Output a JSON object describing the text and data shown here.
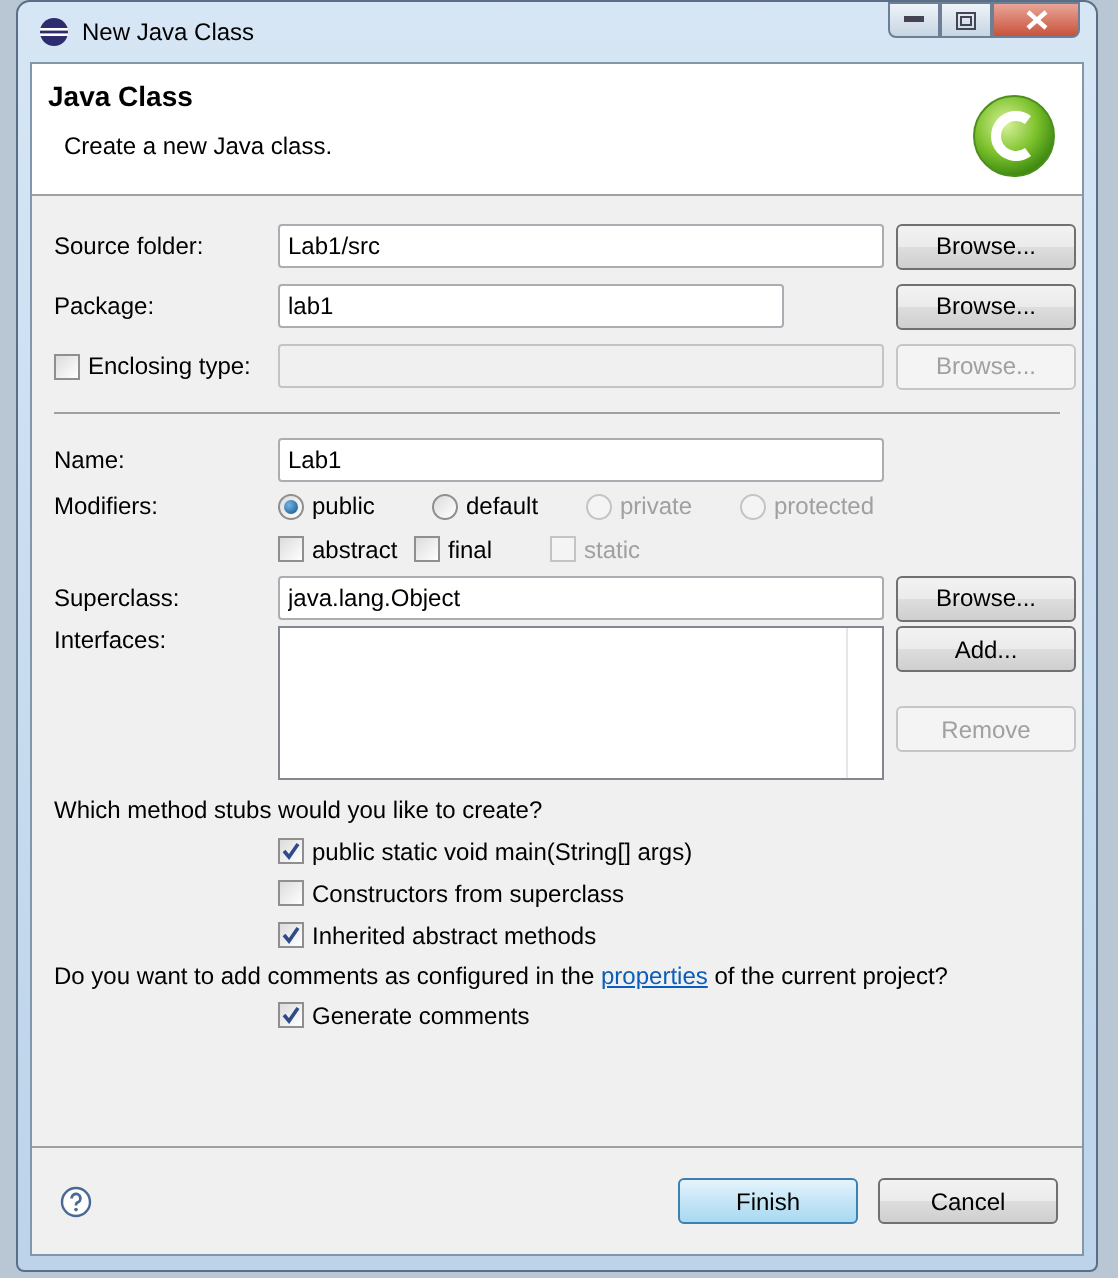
{
  "window": {
    "title": "New Java Class"
  },
  "header": {
    "title": "Java Class",
    "description": "Create a new Java class."
  },
  "location": [
    {
      "kind": "text",
      "label": "Source folder:",
      "value": "Lab1/src",
      "button": {
        "label": "Browse...",
        "disabled": false
      }
    },
    {
      "kind": "text",
      "label": "Package:",
      "value": "lab1",
      "button": {
        "label": "Browse...",
        "disabled": false
      }
    },
    {
      "kind": "checkbox",
      "label": "Enclosing type:",
      "checked": false,
      "disabled": true,
      "button": {
        "label": "Browse...",
        "disabled": true
      }
    }
  ],
  "name": {
    "label": "Name:",
    "value": "Lab1"
  },
  "modifiers": {
    "label": "Modifiers:",
    "access": [
      {
        "label": "public",
        "selected": true,
        "disabled": false
      },
      {
        "label": "default",
        "selected": false,
        "disabled": false
      },
      {
        "label": "private",
        "selected": false,
        "disabled": true
      },
      {
        "label": "protected",
        "selected": false,
        "disabled": true
      }
    ],
    "flags": [
      {
        "label": "abstract",
        "checked": false,
        "disabled": false
      },
      {
        "label": "final",
        "checked": false,
        "disabled": false
      },
      {
        "label": "static",
        "checked": false,
        "disabled": true
      }
    ]
  },
  "superclass": {
    "label": "Superclass:",
    "value": "java.lang.Object",
    "button": {
      "label": "Browse...",
      "disabled": false
    }
  },
  "interfaces": {
    "label": "Interfaces:",
    "buttons": [
      {
        "label": "Add...",
        "disabled": false
      },
      {
        "label": "Remove",
        "disabled": true
      }
    ]
  },
  "stubs": {
    "question": "Which method stubs would you like to create?",
    "options": [
      {
        "label": "public static void main(String[] args)",
        "checked": true
      },
      {
        "label": "Constructors from superclass",
        "checked": false
      },
      {
        "label": "Inherited abstract methods",
        "checked": true
      }
    ]
  },
  "comments": {
    "question_before": "Do you want to add comments as configured in the",
    "link": "properties",
    "question_after": "of the current project?",
    "options": [
      {
        "label": "Generate comments",
        "checked": true
      }
    ]
  },
  "footer": {
    "buttons": [
      {
        "label": "Finish",
        "default": true
      },
      {
        "label": "Cancel",
        "default": false
      }
    ]
  }
}
